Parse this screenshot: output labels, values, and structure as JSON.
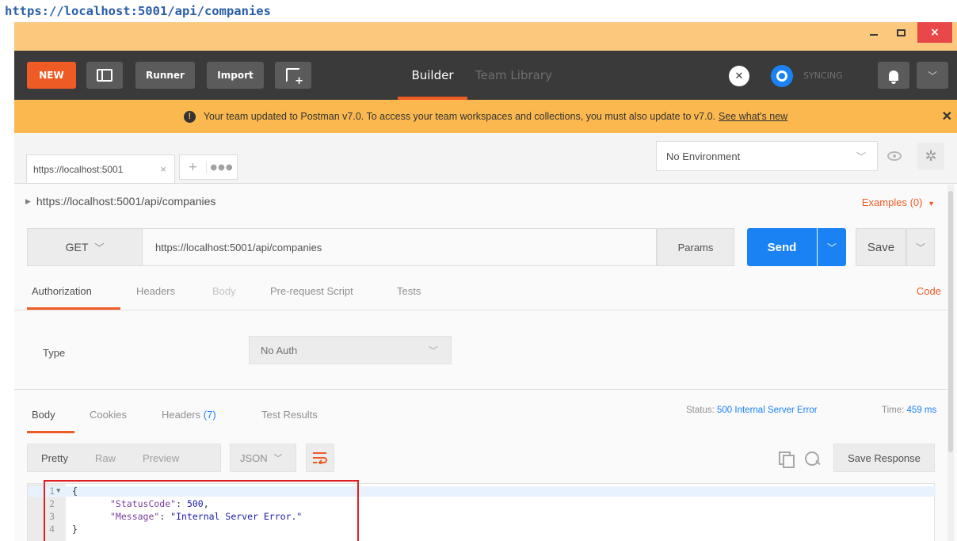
{
  "caption": "https://localhost:5001/api/companies",
  "window": {
    "close_glyph": "×"
  },
  "toolbar": {
    "new_label": "NEW",
    "runner_label": "Runner",
    "import_label": "Import",
    "builder_label": "Builder",
    "team_library_label": "Team Library",
    "syncing_label": "SYNCING",
    "menu_glyph": "﹀"
  },
  "banner": {
    "message": "Your team updated to Postman v7.0. To access your team workspaces and collections, you must also update to v7.0.",
    "link": "See what's new",
    "close_glyph": "✕"
  },
  "request_tab": {
    "label": "https://localhost:5001",
    "close_glyph": "×",
    "add_glyph": "+",
    "more_glyph": "●●●"
  },
  "environment": {
    "selected": "No Environment",
    "chevron": "﹀",
    "gear_glyph": "✲"
  },
  "request": {
    "breadcrumb": "https://localhost:5001/api/companies",
    "examples_label": "Examples (0)",
    "examples_caret": "▼",
    "method": "GET",
    "url": "https://localhost:5001/api/companies",
    "params_label": "Params",
    "send_label": "Send",
    "save_label": "Save",
    "chevron": "﹀"
  },
  "request_tabs": {
    "authorization": "Authorization",
    "headers": "Headers",
    "body": "Body",
    "prerequest": "Pre-request Script",
    "tests": "Tests",
    "code": "Code"
  },
  "auth": {
    "type_label": "Type",
    "selected": "No Auth"
  },
  "response_tabs": {
    "body": "Body",
    "cookies": "Cookies",
    "headers": "Headers",
    "headers_count": "(7)",
    "test_results": "Test Results"
  },
  "response_meta": {
    "status_label": "Status:",
    "status_value": "500 Internal Server Error",
    "time_label": "Time:",
    "time_value": "459 ms"
  },
  "response_view": {
    "pretty": "Pretty",
    "raw": "Raw",
    "preview": "Preview",
    "format": "JSON",
    "save_response": "Save Response"
  },
  "editor": {
    "lines": [
      {
        "n": "1",
        "text": "{"
      },
      {
        "n": "2",
        "key": "\"StatusCode\"",
        "sep": ": ",
        "val": "500",
        "end": ","
      },
      {
        "n": "3",
        "key": "\"Message\"",
        "sep": ": ",
        "val": "\"Internal Server Error.\"",
        "end": ""
      },
      {
        "n": "4",
        "text": "}"
      }
    ]
  },
  "colors": {
    "accent": "#ef5b25",
    "primary": "#1b82f3",
    "toolbar": "#3a3a3a",
    "banner": "#fbb84f",
    "highlight": "#e02020"
  }
}
